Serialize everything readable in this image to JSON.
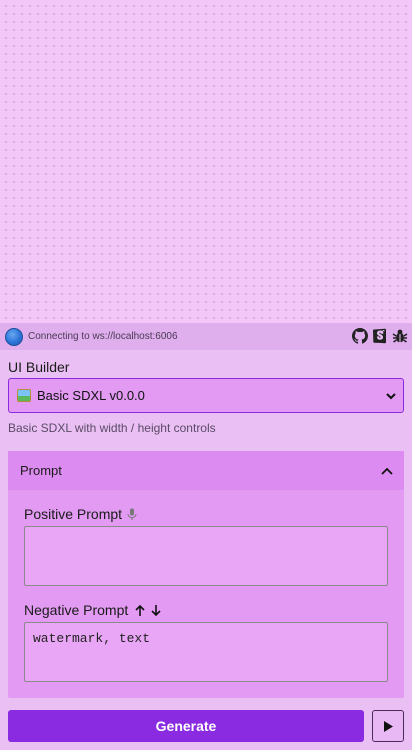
{
  "status": {
    "connection_text": "Connecting to ws://localhost:6006",
    "connection_color": "#2c74d9",
    "icons": [
      "github-icon",
      "storybook-icon",
      "bug-icon"
    ]
  },
  "builder": {
    "label": "UI Builder",
    "selected_preset": "Basic SDXL v0.0.0",
    "description": "Basic SDXL with width / height controls"
  },
  "prompt_section": {
    "title": "Prompt",
    "positive_label": "Positive Prompt",
    "positive_value": "",
    "negative_label": "Negative Prompt",
    "negative_value": "watermark, text"
  },
  "actions": {
    "generate_label": "Generate"
  },
  "colors": {
    "accent": "#8a2be2",
    "background": "#f3c8f9"
  }
}
